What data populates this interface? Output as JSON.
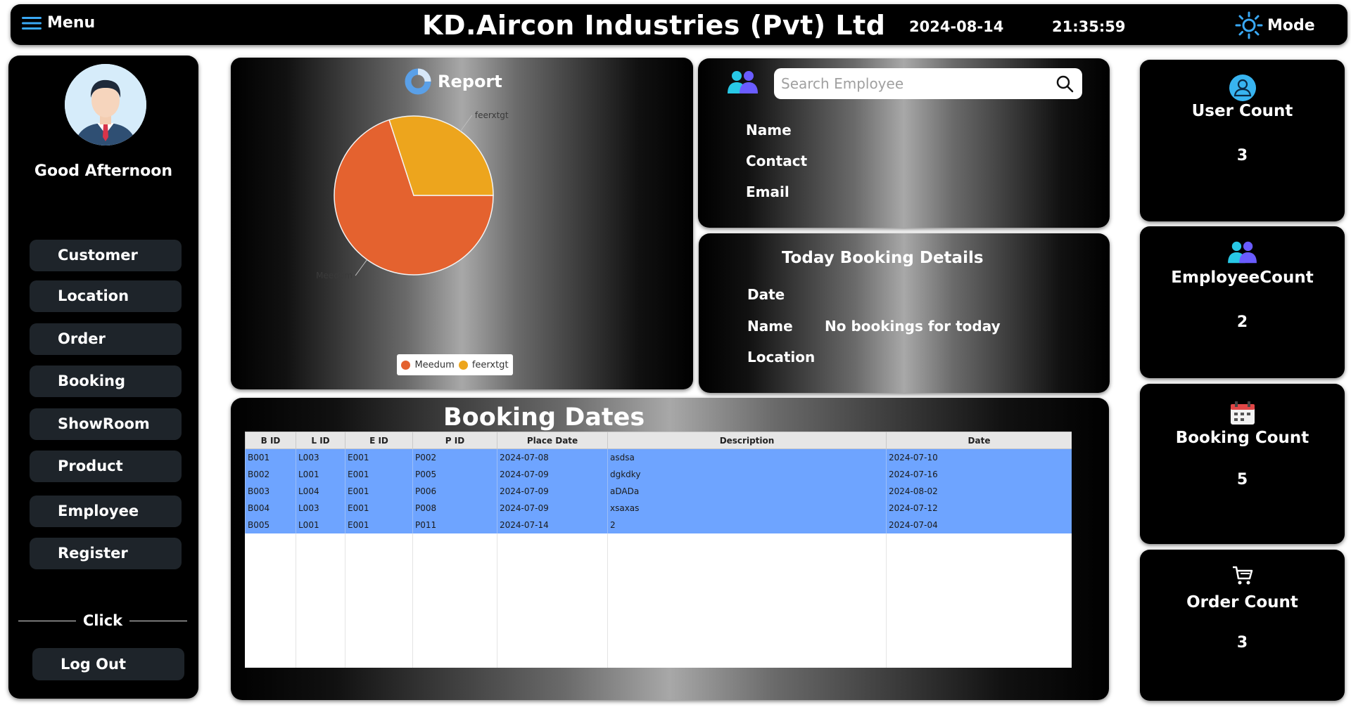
{
  "header": {
    "menu_label": "Menu",
    "title": "KD.Aircon Industries (Pvt) Ltd",
    "date": "2024-08-14",
    "time": "21:35:59",
    "mode_label": "Mode"
  },
  "sidebar": {
    "greeting": "Good Afternoon",
    "items": [
      {
        "label": "Customer"
      },
      {
        "label": "Location"
      },
      {
        "label": "Order"
      },
      {
        "label": "Booking"
      },
      {
        "label": "ShowRoom"
      },
      {
        "label": "Product"
      },
      {
        "label": "Employee"
      },
      {
        "label": "Register"
      }
    ],
    "click_label": "Click",
    "logout_label": "Log Out"
  },
  "report": {
    "title": "Report"
  },
  "chart_data": {
    "type": "pie",
    "categories": [
      "Meedum",
      "feerxtgt"
    ],
    "values": [
      70,
      30
    ],
    "colors": [
      "#e4622f",
      "#eda51d"
    ],
    "legend": [
      "Meedum",
      "feerxtgt"
    ],
    "legend_placement": "bottom"
  },
  "employee": {
    "search_placeholder": "Search Employee",
    "name_label": "Name",
    "contact_label": "Contact",
    "email_label": "Email"
  },
  "today_booking": {
    "title": "Today Booking Details",
    "date_label": "Date",
    "name_label": "Name",
    "location_label": "Location",
    "message": "No bookings for today"
  },
  "booking_dates": {
    "title": "Booking Dates",
    "columns": [
      "B ID",
      "L ID",
      "E ID",
      "P ID",
      "Place Date",
      "Description",
      "Date"
    ],
    "rows": [
      [
        "B001",
        "L003",
        "E001",
        "P002",
        "2024-07-08",
        "asdsa",
        "2024-07-10"
      ],
      [
        "B002",
        "L001",
        "E001",
        "P005",
        "2024-07-09",
        "dgkdky",
        "2024-07-16"
      ],
      [
        "B003",
        "L004",
        "E001",
        "P006",
        "2024-07-09",
        "aDADa",
        "2024-08-02"
      ],
      [
        "B004",
        "L003",
        "E001",
        "P008",
        "2024-07-09",
        "xsaxas",
        "2024-07-12"
      ],
      [
        "B005",
        "L001",
        "E001",
        "P011",
        "2024-07-14",
        "2",
        "2024-07-04"
      ]
    ]
  },
  "stats": {
    "user": {
      "label": "User Count",
      "value": "3"
    },
    "employee": {
      "label": "EmployeeCount",
      "value": "2"
    },
    "booking": {
      "label": "Booking Count",
      "value": "5"
    },
    "order": {
      "label": "Order Count",
      "value": "3"
    }
  },
  "colors": {
    "accent": "#38b4f0",
    "table_row": "#6ea4ff",
    "nav_button": "#1e242a"
  }
}
